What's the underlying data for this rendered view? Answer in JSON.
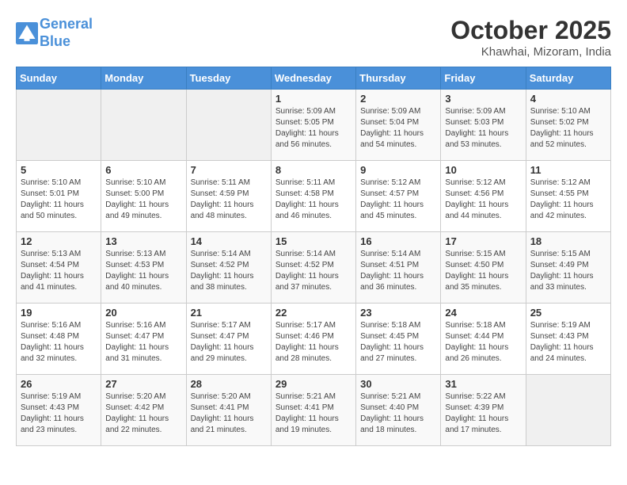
{
  "header": {
    "logo_line1": "General",
    "logo_line2": "Blue",
    "month": "October 2025",
    "location": "Khawhai, Mizoram, India"
  },
  "days_of_week": [
    "Sunday",
    "Monday",
    "Tuesday",
    "Wednesday",
    "Thursday",
    "Friday",
    "Saturday"
  ],
  "weeks": [
    [
      {
        "day": "",
        "sunrise": "",
        "sunset": "",
        "daylight": ""
      },
      {
        "day": "",
        "sunrise": "",
        "sunset": "",
        "daylight": ""
      },
      {
        "day": "",
        "sunrise": "",
        "sunset": "",
        "daylight": ""
      },
      {
        "day": "1",
        "sunrise": "Sunrise: 5:09 AM",
        "sunset": "Sunset: 5:05 PM",
        "daylight": "Daylight: 11 hours and 56 minutes."
      },
      {
        "day": "2",
        "sunrise": "Sunrise: 5:09 AM",
        "sunset": "Sunset: 5:04 PM",
        "daylight": "Daylight: 11 hours and 54 minutes."
      },
      {
        "day": "3",
        "sunrise": "Sunrise: 5:09 AM",
        "sunset": "Sunset: 5:03 PM",
        "daylight": "Daylight: 11 hours and 53 minutes."
      },
      {
        "day": "4",
        "sunrise": "Sunrise: 5:10 AM",
        "sunset": "Sunset: 5:02 PM",
        "daylight": "Daylight: 11 hours and 52 minutes."
      }
    ],
    [
      {
        "day": "5",
        "sunrise": "Sunrise: 5:10 AM",
        "sunset": "Sunset: 5:01 PM",
        "daylight": "Daylight: 11 hours and 50 minutes."
      },
      {
        "day": "6",
        "sunrise": "Sunrise: 5:10 AM",
        "sunset": "Sunset: 5:00 PM",
        "daylight": "Daylight: 11 hours and 49 minutes."
      },
      {
        "day": "7",
        "sunrise": "Sunrise: 5:11 AM",
        "sunset": "Sunset: 4:59 PM",
        "daylight": "Daylight: 11 hours and 48 minutes."
      },
      {
        "day": "8",
        "sunrise": "Sunrise: 5:11 AM",
        "sunset": "Sunset: 4:58 PM",
        "daylight": "Daylight: 11 hours and 46 minutes."
      },
      {
        "day": "9",
        "sunrise": "Sunrise: 5:12 AM",
        "sunset": "Sunset: 4:57 PM",
        "daylight": "Daylight: 11 hours and 45 minutes."
      },
      {
        "day": "10",
        "sunrise": "Sunrise: 5:12 AM",
        "sunset": "Sunset: 4:56 PM",
        "daylight": "Daylight: 11 hours and 44 minutes."
      },
      {
        "day": "11",
        "sunrise": "Sunrise: 5:12 AM",
        "sunset": "Sunset: 4:55 PM",
        "daylight": "Daylight: 11 hours and 42 minutes."
      }
    ],
    [
      {
        "day": "12",
        "sunrise": "Sunrise: 5:13 AM",
        "sunset": "Sunset: 4:54 PM",
        "daylight": "Daylight: 11 hours and 41 minutes."
      },
      {
        "day": "13",
        "sunrise": "Sunrise: 5:13 AM",
        "sunset": "Sunset: 4:53 PM",
        "daylight": "Daylight: 11 hours and 40 minutes."
      },
      {
        "day": "14",
        "sunrise": "Sunrise: 5:14 AM",
        "sunset": "Sunset: 4:52 PM",
        "daylight": "Daylight: 11 hours and 38 minutes."
      },
      {
        "day": "15",
        "sunrise": "Sunrise: 5:14 AM",
        "sunset": "Sunset: 4:52 PM",
        "daylight": "Daylight: 11 hours and 37 minutes."
      },
      {
        "day": "16",
        "sunrise": "Sunrise: 5:14 AM",
        "sunset": "Sunset: 4:51 PM",
        "daylight": "Daylight: 11 hours and 36 minutes."
      },
      {
        "day": "17",
        "sunrise": "Sunrise: 5:15 AM",
        "sunset": "Sunset: 4:50 PM",
        "daylight": "Daylight: 11 hours and 35 minutes."
      },
      {
        "day": "18",
        "sunrise": "Sunrise: 5:15 AM",
        "sunset": "Sunset: 4:49 PM",
        "daylight": "Daylight: 11 hours and 33 minutes."
      }
    ],
    [
      {
        "day": "19",
        "sunrise": "Sunrise: 5:16 AM",
        "sunset": "Sunset: 4:48 PM",
        "daylight": "Daylight: 11 hours and 32 minutes."
      },
      {
        "day": "20",
        "sunrise": "Sunrise: 5:16 AM",
        "sunset": "Sunset: 4:47 PM",
        "daylight": "Daylight: 11 hours and 31 minutes."
      },
      {
        "day": "21",
        "sunrise": "Sunrise: 5:17 AM",
        "sunset": "Sunset: 4:47 PM",
        "daylight": "Daylight: 11 hours and 29 minutes."
      },
      {
        "day": "22",
        "sunrise": "Sunrise: 5:17 AM",
        "sunset": "Sunset: 4:46 PM",
        "daylight": "Daylight: 11 hours and 28 minutes."
      },
      {
        "day": "23",
        "sunrise": "Sunrise: 5:18 AM",
        "sunset": "Sunset: 4:45 PM",
        "daylight": "Daylight: 11 hours and 27 minutes."
      },
      {
        "day": "24",
        "sunrise": "Sunrise: 5:18 AM",
        "sunset": "Sunset: 4:44 PM",
        "daylight": "Daylight: 11 hours and 26 minutes."
      },
      {
        "day": "25",
        "sunrise": "Sunrise: 5:19 AM",
        "sunset": "Sunset: 4:43 PM",
        "daylight": "Daylight: 11 hours and 24 minutes."
      }
    ],
    [
      {
        "day": "26",
        "sunrise": "Sunrise: 5:19 AM",
        "sunset": "Sunset: 4:43 PM",
        "daylight": "Daylight: 11 hours and 23 minutes."
      },
      {
        "day": "27",
        "sunrise": "Sunrise: 5:20 AM",
        "sunset": "Sunset: 4:42 PM",
        "daylight": "Daylight: 11 hours and 22 minutes."
      },
      {
        "day": "28",
        "sunrise": "Sunrise: 5:20 AM",
        "sunset": "Sunset: 4:41 PM",
        "daylight": "Daylight: 11 hours and 21 minutes."
      },
      {
        "day": "29",
        "sunrise": "Sunrise: 5:21 AM",
        "sunset": "Sunset: 4:41 PM",
        "daylight": "Daylight: 11 hours and 19 minutes."
      },
      {
        "day": "30",
        "sunrise": "Sunrise: 5:21 AM",
        "sunset": "Sunset: 4:40 PM",
        "daylight": "Daylight: 11 hours and 18 minutes."
      },
      {
        "day": "31",
        "sunrise": "Sunrise: 5:22 AM",
        "sunset": "Sunset: 4:39 PM",
        "daylight": "Daylight: 11 hours and 17 minutes."
      },
      {
        "day": "",
        "sunrise": "",
        "sunset": "",
        "daylight": ""
      }
    ]
  ]
}
